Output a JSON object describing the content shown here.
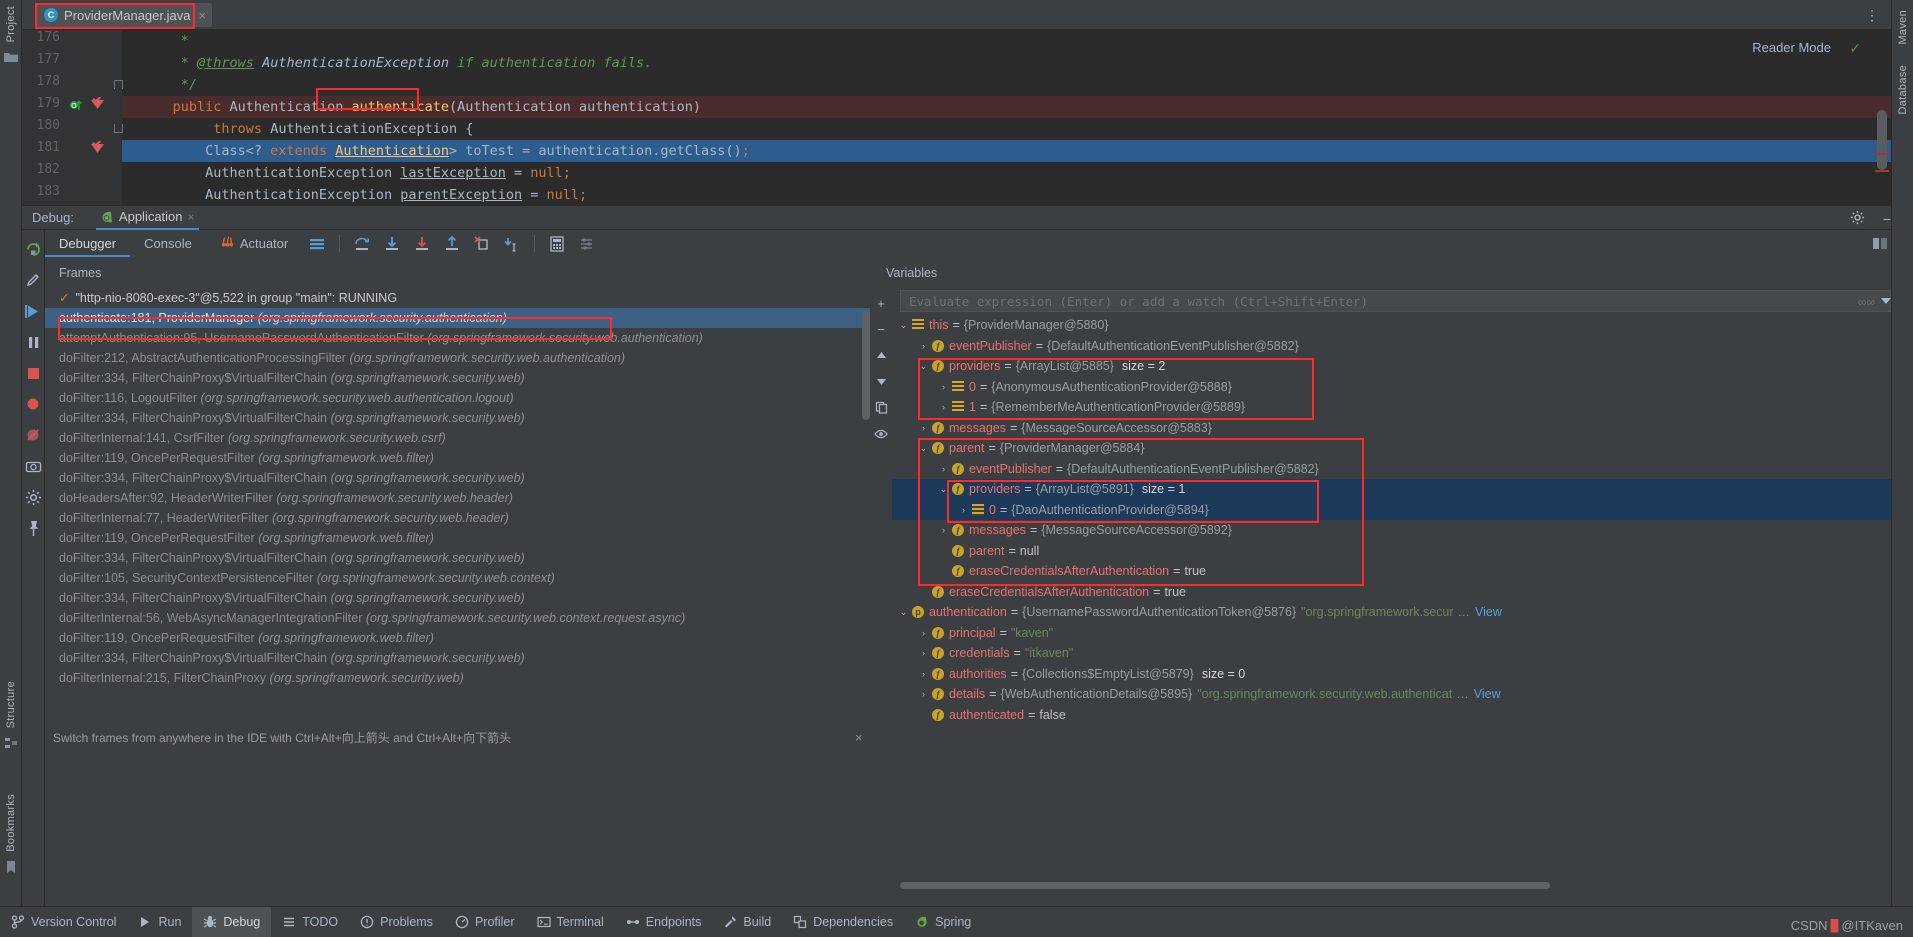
{
  "editor": {
    "tab": {
      "filename": "ProviderManager.java",
      "icon": "java-class-icon",
      "close": "×"
    },
    "reader_mode": "Reader Mode",
    "lines": [
      {
        "num": "176",
        "text": " *"
      },
      {
        "num": "177",
        "text": " * @throws AuthenticationException if authentication fails."
      },
      {
        "num": "178",
        "text": " */"
      },
      {
        "num": "179",
        "text": "public Authentication authenticate(Authentication authentication)"
      },
      {
        "num": "180",
        "text": "    throws AuthenticationException {"
      },
      {
        "num": "181",
        "text": "    Class<? extends Authentication> toTest = authentication.getClass();"
      },
      {
        "num": "182",
        "text": "    AuthenticationException lastException = null;"
      },
      {
        "num": "183",
        "text": "    AuthenticationException parentException = null;"
      }
    ],
    "highlighted_method": "authenticate"
  },
  "debug_header": {
    "label": "Debug:",
    "session_tab": "Application",
    "close": "×",
    "gear_icon": "settings-icon",
    "minimize_icon": "minimize-icon"
  },
  "debug_toolbar": {
    "tabs": [
      {
        "label": "Debugger",
        "active": true
      },
      {
        "label": "Console",
        "active": false
      },
      {
        "label": "Actuator",
        "active": false,
        "icon": "actuator-icon"
      }
    ],
    "buttons": [
      {
        "name": "layout-settings-icon"
      },
      {
        "name": "step-over-icon"
      },
      {
        "name": "step-into-icon"
      },
      {
        "name": "force-step-into-icon"
      },
      {
        "name": "step-out-icon"
      },
      {
        "name": "drop-frame-icon"
      },
      {
        "name": "run-to-cursor-icon"
      },
      {
        "name": "evaluate-expression-icon"
      },
      {
        "name": "settings-list-icon"
      }
    ],
    "rerun_icon": "rerun-icon",
    "restore-layout-icon": "restore-layout-icon"
  },
  "side_strip": {
    "icons": [
      "rerun-icon",
      "edit-config-icon",
      "resume-icon",
      "pause-icon",
      "stop-icon",
      "view-breakpoints-icon",
      "mute-breakpoints-icon",
      "screenshot-icon",
      "settings-icon",
      "pin-icon"
    ]
  },
  "frames": {
    "title": "Frames",
    "filter_icon": "filter-icon",
    "dropdown_icon": "chevron-down-icon",
    "thread": "\"http-nio-8080-exec-3\"@5,522 in group \"main\": RUNNING",
    "items": [
      {
        "method": "authenticate:181, ProviderManager",
        "pkg": "(org.springframework.security.authentication)",
        "selected": true
      },
      {
        "method": "attemptAuthentication:95, UsernamePasswordAuthenticationFilter",
        "pkg": "(org.springframework.security.web.authentication)",
        "selected": false
      },
      {
        "method": "doFilter:212, AbstractAuthenticationProcessingFilter",
        "pkg": "(org.springframework.security.web.authentication)",
        "selected": false
      },
      {
        "method": "doFilter:334, FilterChainProxy$VirtualFilterChain",
        "pkg": "(org.springframework.security.web)",
        "selected": false
      },
      {
        "method": "doFilter:116, LogoutFilter",
        "pkg": "(org.springframework.security.web.authentication.logout)",
        "selected": false
      },
      {
        "method": "doFilter:334, FilterChainProxy$VirtualFilterChain",
        "pkg": "(org.springframework.security.web)",
        "selected": false
      },
      {
        "method": "doFilterInternal:141, CsrfFilter",
        "pkg": "(org.springframework.security.web.csrf)",
        "selected": false
      },
      {
        "method": "doFilter:119, OncePerRequestFilter",
        "pkg": "(org.springframework.web.filter)",
        "selected": false
      },
      {
        "method": "doFilter:334, FilterChainProxy$VirtualFilterChain",
        "pkg": "(org.springframework.security.web)",
        "selected": false
      },
      {
        "method": "doHeadersAfter:92, HeaderWriterFilter",
        "pkg": "(org.springframework.security.web.header)",
        "selected": false
      },
      {
        "method": "doFilterInternal:77, HeaderWriterFilter",
        "pkg": "(org.springframework.security.web.header)",
        "selected": false
      },
      {
        "method": "doFilter:119, OncePerRequestFilter",
        "pkg": "(org.springframework.web.filter)",
        "selected": false
      },
      {
        "method": "doFilter:334, FilterChainProxy$VirtualFilterChain",
        "pkg": "(org.springframework.security.web)",
        "selected": false
      },
      {
        "method": "doFilter:105, SecurityContextPersistenceFilter",
        "pkg": "(org.springframework.security.web.context)",
        "selected": false
      },
      {
        "method": "doFilter:334, FilterChainProxy$VirtualFilterChain",
        "pkg": "(org.springframework.security.web)",
        "selected": false
      },
      {
        "method": "doFilterInternal:56, WebAsyncManagerIntegrationFilter",
        "pkg": "(org.springframework.security.web.context.request.async)",
        "selected": false
      },
      {
        "method": "doFilter:119, OncePerRequestFilter",
        "pkg": "(org.springframework.web.filter)",
        "selected": false
      },
      {
        "method": "doFilter:334, FilterChainProxy$VirtualFilterChain",
        "pkg": "(org.springframework.security.web)",
        "selected": false
      },
      {
        "method": "doFilterInternal:215, FilterChainProxy",
        "pkg": "(org.springframework.security.web)",
        "selected": false
      }
    ]
  },
  "variables": {
    "title": "Variables",
    "add_watch_icon": "plus-icon",
    "remove_watch_icon": "minus-icon",
    "up_icon": "chevron-up-icon",
    "down_icon": "chevron-down-icon",
    "copy_icon": "copy-icon",
    "eye_icon": "eye-icon",
    "eval_placeholder": "Evaluate expression (Enter) or add a watch (Ctrl+Shift+Enter)",
    "rows": [
      {
        "indent": 0,
        "arrow": "⌄",
        "icon": "arr",
        "name": "this",
        "value": "{ProviderManager@5880}",
        "extra": "",
        "highlight": false
      },
      {
        "indent": 1,
        "arrow": "›",
        "icon": "f",
        "name": "eventPublisher",
        "value": "{DefaultAuthenticationEventPublisher@5882}",
        "extra": "",
        "highlight": false
      },
      {
        "indent": 1,
        "arrow": "⌄",
        "icon": "f",
        "name": "providers",
        "value": "{ArrayList@5885}",
        "extra": "size = 2",
        "highlight": false
      },
      {
        "indent": 2,
        "arrow": "›",
        "icon": "arr",
        "name": "0",
        "value": "{AnonymousAuthenticationProvider@5888}",
        "extra": "",
        "highlight": false
      },
      {
        "indent": 2,
        "arrow": "›",
        "icon": "arr",
        "name": "1",
        "value": "{RememberMeAuthenticationProvider@5889}",
        "extra": "",
        "highlight": false
      },
      {
        "indent": 1,
        "arrow": "›",
        "icon": "f",
        "name": "messages",
        "value": "{MessageSourceAccessor@5883}",
        "extra": "",
        "highlight": false
      },
      {
        "indent": 1,
        "arrow": "⌄",
        "icon": "f",
        "name": "parent",
        "value": "{ProviderManager@5884}",
        "extra": "",
        "highlight": false
      },
      {
        "indent": 2,
        "arrow": "›",
        "icon": "f",
        "name": "eventPublisher",
        "value": "{DefaultAuthenticationEventPublisher@5882}",
        "extra": "",
        "highlight": false
      },
      {
        "indent": 2,
        "arrow": "⌄",
        "icon": "f",
        "name": "providers",
        "value": "{ArrayList@5891}",
        "extra": "size = 1",
        "highlight": true
      },
      {
        "indent": 3,
        "arrow": "›",
        "icon": "arr",
        "name": "0",
        "value": "{DaoAuthenticationProvider@5894}",
        "extra": "",
        "highlight": true
      },
      {
        "indent": 2,
        "arrow": "›",
        "icon": "f",
        "name": "messages",
        "value": "{MessageSourceAccessor@5892}",
        "extra": "",
        "highlight": false
      },
      {
        "indent": 2,
        "arrow": "",
        "icon": "f",
        "name": "parent",
        "value": "null",
        "extra": "",
        "highlight": false,
        "literal": true
      },
      {
        "indent": 2,
        "arrow": "",
        "icon": "f",
        "name": "eraseCredentialsAfterAuthentication",
        "value": "true",
        "extra": "",
        "highlight": false,
        "literal": true
      },
      {
        "indent": 1,
        "arrow": "",
        "icon": "f",
        "name": "eraseCredentialsAfterAuthentication",
        "value": "true",
        "extra": "",
        "highlight": false,
        "literal": true
      },
      {
        "indent": 0,
        "arrow": "⌄",
        "icon": "p",
        "name": "authentication",
        "value": "{UsernamePasswordAuthenticationToken@5876}",
        "extra": "",
        "str": "\"org.springframework.secur",
        "more": "…",
        "view": "View",
        "highlight": false
      },
      {
        "indent": 1,
        "arrow": "›",
        "icon": "f",
        "name": "principal",
        "value": "",
        "str": "\"kaven\"",
        "extra": "",
        "highlight": false
      },
      {
        "indent": 1,
        "arrow": "›",
        "icon": "f",
        "name": "credentials",
        "value": "",
        "str": "\"itkaven\"",
        "extra": "",
        "highlight": false
      },
      {
        "indent": 1,
        "arrow": "›",
        "icon": "f",
        "name": "authorities",
        "value": "{Collections$EmptyList@5879}",
        "extra": "size = 0",
        "highlight": false
      },
      {
        "indent": 1,
        "arrow": "›",
        "icon": "f",
        "name": "details",
        "value": "{WebAuthenticationDetails@5895}",
        "str": "\"org.springframework.security.web.authenticat",
        "more": "…",
        "view": "View",
        "extra": "",
        "highlight": false
      },
      {
        "indent": 1,
        "arrow": "",
        "icon": "f",
        "name": "authenticated",
        "value": "false",
        "extra": "",
        "highlight": false,
        "literal": true
      }
    ]
  },
  "hint": {
    "text": "Switch frames from anywhere in the IDE with Ctrl+Alt+向上箭头 and Ctrl+Alt+向下箭头",
    "close": "×"
  },
  "left_rail": {
    "top_label": "Project",
    "mid_label": "Structure",
    "bottom_label": "Bookmarks"
  },
  "right_rail": {
    "top_label": "Maven",
    "mid_label": "Database"
  },
  "statusbar": {
    "items": [
      {
        "label": "Version Control",
        "icon": "branch-icon",
        "active": false
      },
      {
        "label": "Run",
        "icon": "play-icon",
        "active": false
      },
      {
        "label": "Debug",
        "icon": "debug-icon",
        "active": true
      },
      {
        "label": "TODO",
        "icon": "todo-icon",
        "active": false
      },
      {
        "label": "Problems",
        "icon": "problems-icon",
        "active": false
      },
      {
        "label": "Profiler",
        "icon": "profiler-icon",
        "active": false
      },
      {
        "label": "Terminal",
        "icon": "terminal-icon",
        "active": false
      },
      {
        "label": "Endpoints",
        "icon": "endpoints-icon",
        "active": false
      },
      {
        "label": "Build",
        "icon": "build-icon",
        "active": false
      },
      {
        "label": "Dependencies",
        "icon": "dependencies-icon",
        "active": false
      },
      {
        "label": "Spring",
        "icon": "spring-icon",
        "active": false
      }
    ]
  },
  "watermark": {
    "prefix": "CSDN",
    "suffix": "@ITKaven"
  },
  "colors": {
    "accent_blue": "#4a88c7",
    "selection_blue": "#3d6185",
    "annotation_red": "#ff2a2a",
    "keyword_orange": "#cc7832",
    "method_yellow": "#ffc66d",
    "comment_green": "#629755",
    "var_name_red": "#e8716f",
    "string_green": "#6a8759",
    "panel_bg": "#3c3f41",
    "editor_bg": "#2b2b2b"
  }
}
